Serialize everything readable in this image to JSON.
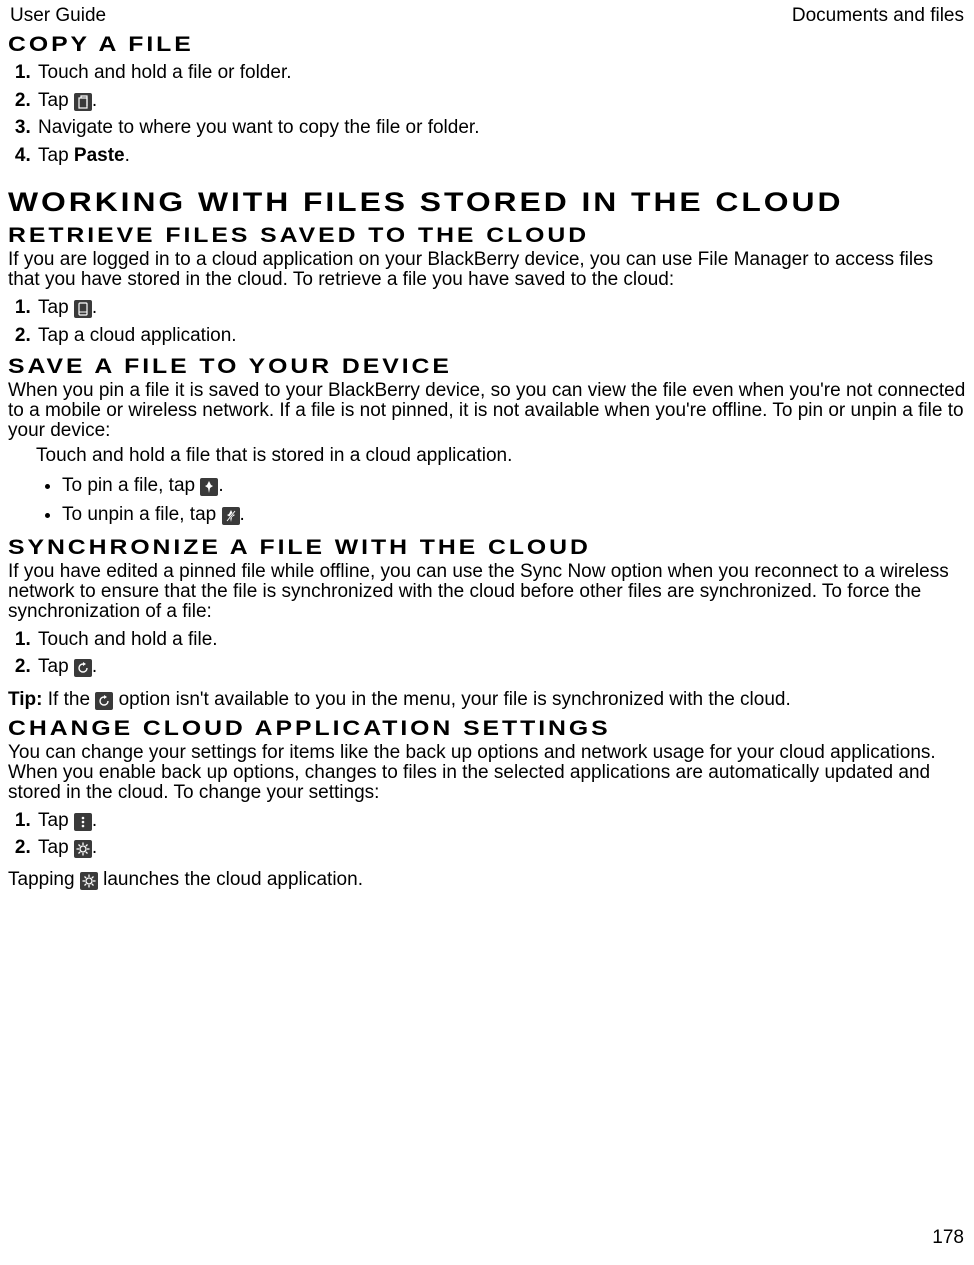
{
  "header": {
    "left": "User Guide",
    "right": "Documents and files"
  },
  "pagenum": "178",
  "copy": {
    "title": "Copy a file",
    "s1": "Touch and hold a file or folder.",
    "s2a": "Tap ",
    "s2b": ".",
    "s3": "Navigate to where you want to copy the file or folder.",
    "s4a": "Tap ",
    "s4bold": "Paste",
    "s4b": "."
  },
  "cloud_h2": "Working with files stored in the cloud",
  "retrieve": {
    "title": "Retrieve files saved to the cloud",
    "para": "If you are logged in to a cloud application on your BlackBerry device, you can use File Manager to access files that you have stored in the cloud. To retrieve a file you have saved to the cloud:",
    "s1a": "Tap ",
    "s1b": ".",
    "s2": "Tap a cloud application."
  },
  "save": {
    "title": "Save a file to your device",
    "para": "When you pin a file it is saved to your BlackBerry device, so you can view the file even when you're not connected to a mobile or wireless network. If a file is not pinned, it is not available when you're offline. To pin or unpin a file to your device:",
    "lead": "Touch and hold a file that is stored in a cloud application.",
    "b1a": "To pin a file, tap ",
    "b1b": ".",
    "b2a": "To unpin a file, tap ",
    "b2b": "."
  },
  "sync": {
    "title": "Synchronize a file with the cloud",
    "para": "If you have edited a pinned file while offline, you can use the Sync Now option when you reconnect to a wireless network to ensure that the file is synchronized with the cloud before other files are synchronized. To force the synchronization of a file:",
    "s1": "Touch and hold a file.",
    "s2a": "Tap ",
    "s2b": ".",
    "tip_label": "Tip:",
    "tip_a": " If the ",
    "tip_b": " option isn't available to you in the menu, your file is synchronized with the cloud."
  },
  "settings": {
    "title": "Change cloud application settings",
    "para": "You can change your settings for items like the back up options and network usage for your cloud applications. When you enable back up options, changes to files in the selected applications are automatically updated and stored in the cloud. To change your settings:",
    "s1a": "Tap ",
    "s1b": ".",
    "s2a": "Tap ",
    "s2b": ".",
    "foot_a": "Tapping ",
    "foot_b": " launches the cloud application."
  }
}
